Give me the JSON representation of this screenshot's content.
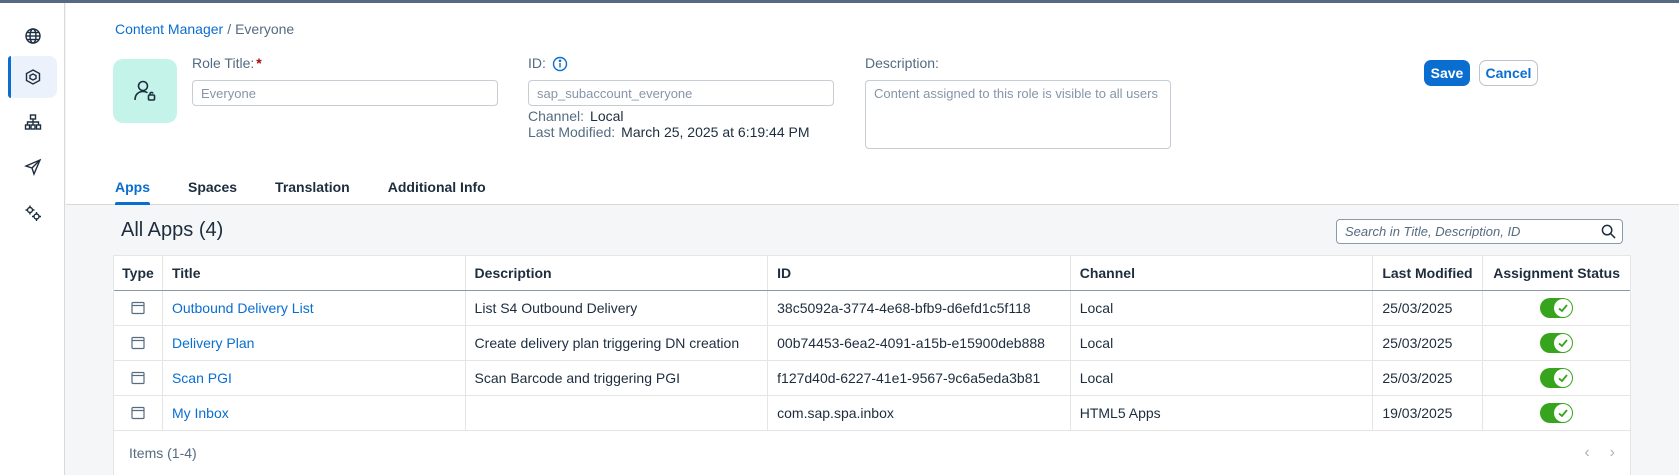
{
  "breadcrumb": {
    "parent": "Content Manager",
    "separator": "/",
    "current": "Everyone"
  },
  "form": {
    "role_title_label": "Role Title:",
    "role_title_required": "*",
    "role_title_placeholder": "Everyone",
    "id_label": "ID:",
    "id_placeholder": "sap_subaccount_everyone",
    "channel_label": "Channel:",
    "channel_value": "Local",
    "last_modified_label": "Last Modified:",
    "last_modified_value": "March 25, 2025 at 6:19:44 PM",
    "description_label": "Description:",
    "description_placeholder": "Content assigned to this role is visible to all users"
  },
  "actions": {
    "save": "Save",
    "cancel": "Cancel"
  },
  "tabs": [
    {
      "label": "Apps",
      "active": true
    },
    {
      "label": "Spaces",
      "active": false
    },
    {
      "label": "Translation",
      "active": false
    },
    {
      "label": "Additional Info",
      "active": false
    }
  ],
  "apps": {
    "title": "All Apps (4)",
    "search_placeholder": "Search in Title, Description, ID",
    "columns": [
      "Type",
      "Title",
      "Description",
      "ID",
      "Channel",
      "Last Modified",
      "Assignment Status"
    ],
    "rows": [
      {
        "title": "Outbound Delivery List",
        "description": "List S4 Outbound Delivery",
        "id": "38c5092a-3774-4e68-bfb9-d6efd1c5f118",
        "channel": "Local",
        "modified": "25/03/2025",
        "assigned": true
      },
      {
        "title": "Delivery Plan",
        "description": "Create delivery plan triggering DN creation",
        "id": "00b74453-6ea2-4091-a15b-e15900deb888",
        "channel": "Local",
        "modified": "25/03/2025",
        "assigned": true
      },
      {
        "title": "Scan PGI",
        "description": "Scan Barcode and triggering PGI",
        "id": "f127d40d-6227-41e1-9567-9c6a5eda3b81",
        "channel": "Local",
        "modified": "25/03/2025",
        "assigned": true
      },
      {
        "title": "My Inbox",
        "description": "",
        "id": "com.sap.spa.inbox",
        "channel": "HTML5 Apps",
        "modified": "19/03/2025",
        "assigned": true
      }
    ],
    "footer": "Items (1-4)"
  },
  "colors": {
    "accent": "#0a6ed1",
    "toggle_on": "#36a41d",
    "avatar_bg": "#c4f3ea"
  },
  "sidebar": {
    "items": [
      {
        "icon": "globe-icon",
        "active": false
      },
      {
        "icon": "cube-icon",
        "active": true
      },
      {
        "icon": "hierarchy-icon",
        "active": false
      },
      {
        "icon": "paper-plane-icon",
        "active": false
      },
      {
        "icon": "settings-gears-icon",
        "active": false
      }
    ]
  }
}
